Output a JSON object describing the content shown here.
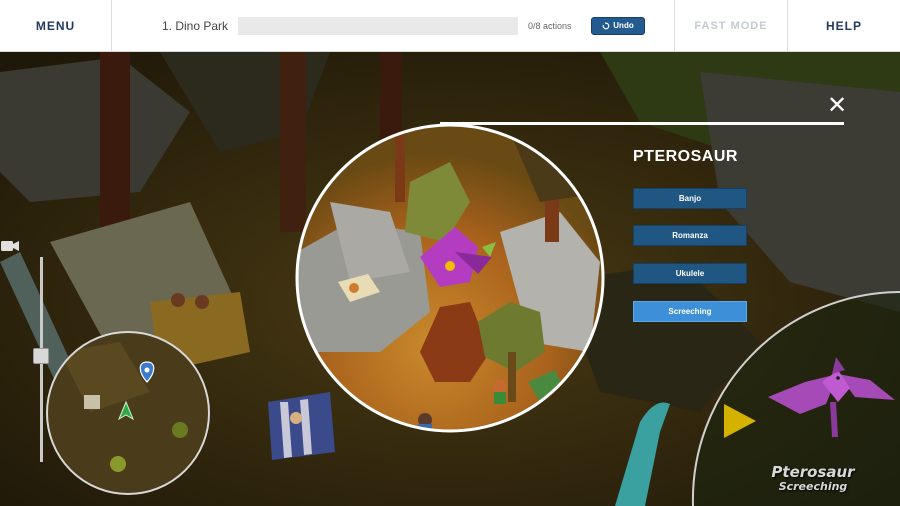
{
  "topbar": {
    "menu_label": "MENU",
    "level_name": "1. Dino Park",
    "progress_fraction": 0,
    "actions_text": "0/8 actions",
    "undo_label": "Undo",
    "fast_mode_label": "FAST MODE",
    "help_label": "HELP"
  },
  "panel": {
    "title": "PTEROSAUR",
    "options": [
      {
        "label": "Banjo",
        "selected": false
      },
      {
        "label": "Romanza",
        "selected": false
      },
      {
        "label": "Ukulele",
        "selected": false
      },
      {
        "label": "Screeching",
        "selected": true
      }
    ]
  },
  "preview": {
    "caption_name": "Pterosaur",
    "caption_sound": "Screeching"
  },
  "icons": {
    "close": "close-icon",
    "undo": "undo-icon",
    "camera": "camera-icon",
    "play": "play-icon",
    "location": "location-pin-icon",
    "player": "player-arrow-icon"
  },
  "colors": {
    "button_blue": "#205682",
    "button_selected": "#3d8fd8",
    "play_yellow": "#d6b200",
    "pterosaur_purple": "#a64ab8"
  }
}
